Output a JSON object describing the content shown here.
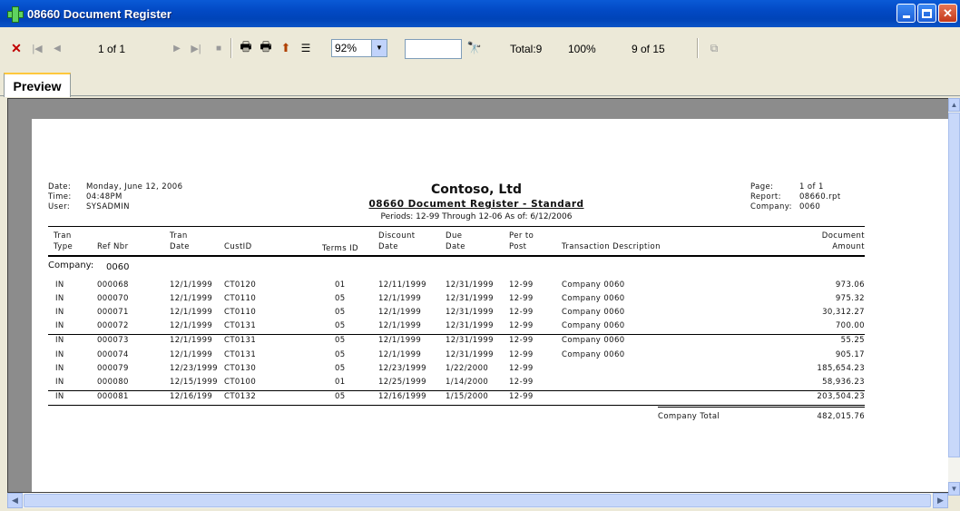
{
  "window": {
    "title": "08660 Document Register"
  },
  "toolbar": {
    "page_indicator": "1 of 1",
    "zoom": "92%",
    "search_value": "",
    "total": "Total:9",
    "percent": "100%",
    "records": "9 of 15"
  },
  "tab": {
    "label": "Preview"
  },
  "report": {
    "header_left": {
      "date_label": "Date:",
      "date_value": "Monday, June 12, 2006",
      "time_label": "Time:",
      "time_value": "04:48PM",
      "user_label": "User:",
      "user_value": "SYSADMIN"
    },
    "company_name": "Contoso, Ltd",
    "report_name": "08660 Document Register - Standard",
    "periods": "Periods: 12-99 Through 12-06 As of: 6/12/2006",
    "header_right": {
      "page_label": "Page:",
      "page_value": "1 of 1",
      "report_label": "Report:",
      "report_value": "08660.rpt",
      "company_label": "Company:",
      "company_value": "0060"
    },
    "columns": {
      "tran_type_1": "Tran",
      "tran_type_2": "Type",
      "ref_nbr": "Ref Nbr",
      "tran_date_1": "Tran",
      "tran_date_2": "Date",
      "cust_id": "CustID",
      "terms_id": "Terms ID",
      "discount_date_1": "Discount",
      "discount_date_2": "Date",
      "due_date_1": "Due",
      "due_date_2": "Date",
      "per_to_post_1": "Per to",
      "per_to_post_2": "Post",
      "transaction_description": "Transaction Description",
      "document_amount_1": "Document",
      "document_amount_2": "Amount"
    },
    "company_label": "Company:",
    "company_value": "0060",
    "rows": [
      {
        "type": "IN",
        "ref": "000068",
        "tran_date": "12/1/1999",
        "cust": "CT0120",
        "terms": "01",
        "disc": "12/11/1999",
        "due": "12/31/1999",
        "per": "12-99",
        "desc": "Company 0060",
        "amount": "973.06"
      },
      {
        "type": "IN",
        "ref": "000070",
        "tran_date": "12/1/1999",
        "cust": "CT0110",
        "terms": "05",
        "disc": "12/1/1999",
        "due": "12/31/1999",
        "per": "12-99",
        "desc": "Company 0060",
        "amount": "975.32"
      },
      {
        "type": "IN",
        "ref": "000071",
        "tran_date": "12/1/1999",
        "cust": "CT0110",
        "terms": "05",
        "disc": "12/1/1999",
        "due": "12/31/1999",
        "per": "12-99",
        "desc": "Company 0060",
        "amount": "30,312.27"
      },
      {
        "type": "IN",
        "ref": "000072",
        "tran_date": "12/1/1999",
        "cust": "CT0131",
        "terms": "05",
        "disc": "12/1/1999",
        "due": "12/31/1999",
        "per": "12-99",
        "desc": "Company 0060",
        "amount": "700.00"
      },
      {
        "type": "IN",
        "ref": "000073",
        "tran_date": "12/1/1999",
        "cust": "CT0131",
        "terms": "05",
        "disc": "12/1/1999",
        "due": "12/31/1999",
        "per": "12-99",
        "desc": "Company 0060",
        "amount": "55.25"
      },
      {
        "type": "IN",
        "ref": "000074",
        "tran_date": "12/1/1999",
        "cust": "CT0131",
        "terms": "05",
        "disc": "12/1/1999",
        "due": "12/31/1999",
        "per": "12-99",
        "desc": "Company 0060",
        "amount": "905.17"
      },
      {
        "type": "IN",
        "ref": "000079",
        "tran_date": "12/23/1999",
        "cust": "CT0130",
        "terms": "05",
        "disc": "12/23/1999",
        "due": "1/22/2000",
        "per": "12-99",
        "desc": "",
        "amount": "185,654.23"
      },
      {
        "type": "IN",
        "ref": "000080",
        "tran_date": "12/15/1999",
        "cust": "CT0100",
        "terms": "01",
        "disc": "12/25/1999",
        "due": "1/14/2000",
        "per": "12-99",
        "desc": "",
        "amount": "58,936.23"
      },
      {
        "type": "IN",
        "ref": "000081",
        "tran_date": "12/16/199",
        "cust": "CT0132",
        "terms": "05",
        "disc": "12/16/1999",
        "due": "1/15/2000",
        "per": "12-99",
        "desc": "",
        "amount": "203,504.23"
      }
    ],
    "company_total_label": "Company Total",
    "company_total_value": "482,015.76"
  },
  "colors": {
    "titlebar": "#0249c4",
    "tab_accent": "#ffc83c",
    "viewport_bg": "#8c8c8c"
  }
}
